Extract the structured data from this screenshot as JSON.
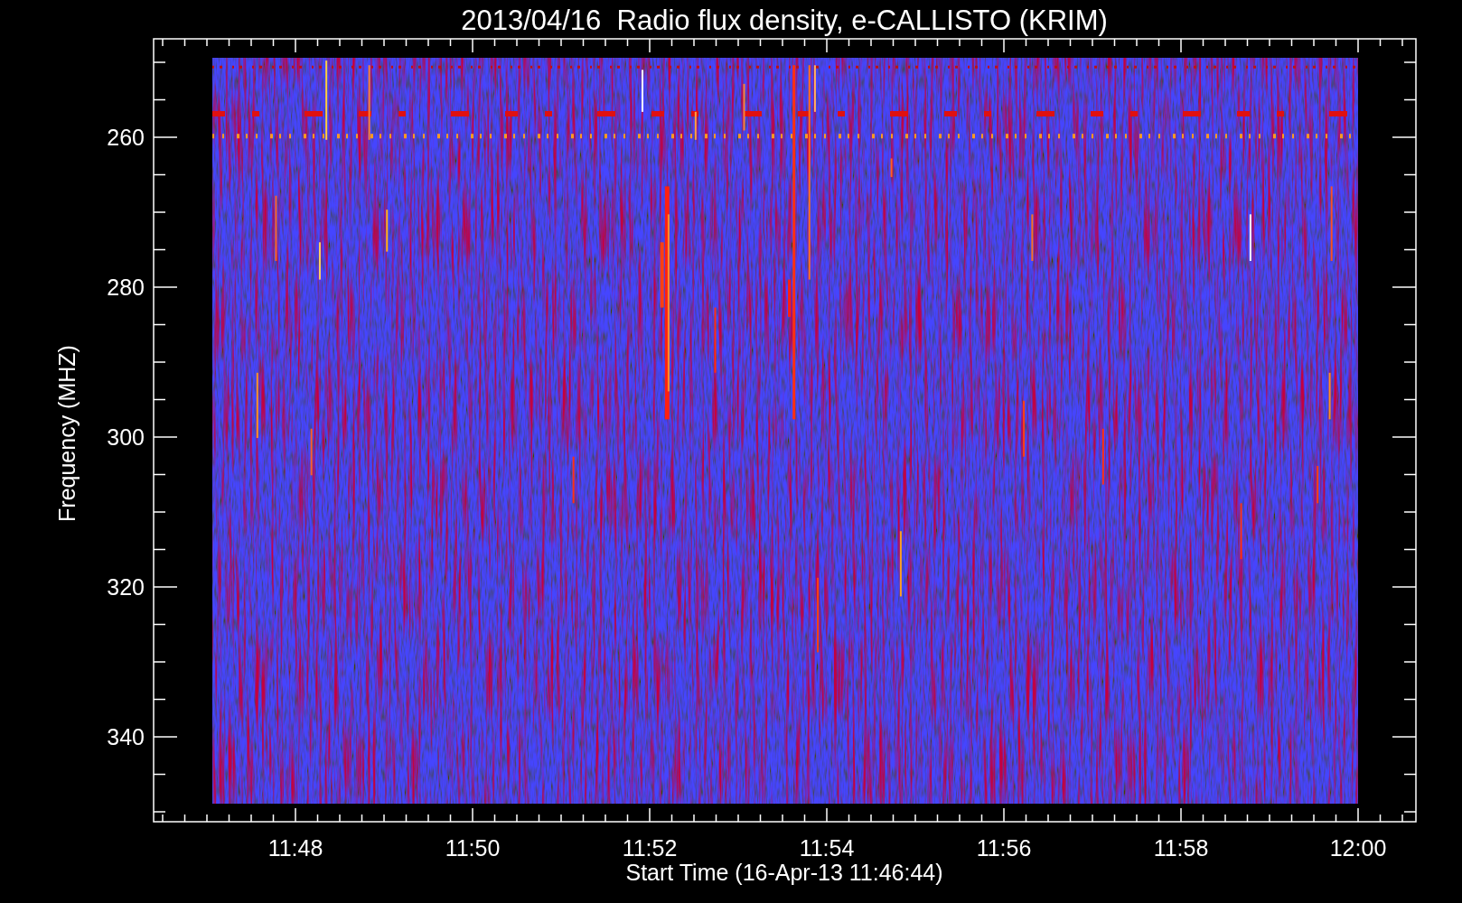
{
  "chart": {
    "title": "2013/04/16  Radio flux density, e-CALLISTO (KRIM)",
    "xlabel": "Start Time (16-Apr-13 11:46:44)",
    "ylabel": "Frequency (MHZ)",
    "xtick_labels": [
      "11:48",
      "11:50",
      "11:52",
      "11:54",
      "11:56",
      "11:58",
      "12:00"
    ],
    "ytick_labels": [
      "260",
      "280",
      "300",
      "320",
      "340"
    ]
  }
}
